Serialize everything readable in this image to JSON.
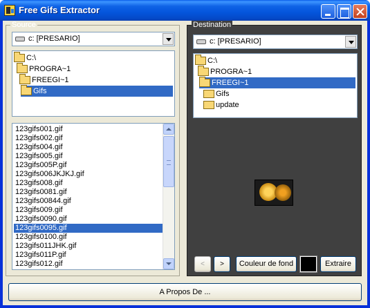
{
  "window": {
    "title": "Free Gifs Extractor"
  },
  "source": {
    "legend": "Source",
    "drive": "c: [PRESARIO]",
    "tree": [
      "C:\\",
      "PROGRA~1",
      "FREEGI~1",
      "Gifs"
    ],
    "selected_tree_index": 3,
    "files": [
      "123gifs001.gif",
      "123gifs002.gif",
      "123gifs004.gif",
      "123gifs005.gif",
      "123gifs005P.gif",
      "123gifs006JKJKJ.gif",
      "123gifs008.gif",
      "123gifs0081.gif",
      "123gifs00844.gif",
      "123gifs009.gif",
      "123gifs0090.gif",
      "123gifs0095.gif",
      "123gifs0100.gif",
      "123gifs011JHK.gif",
      "123gifs011P.gif",
      "123gifs012.gif"
    ],
    "selected_file_index": 11
  },
  "destination": {
    "legend": "Destination",
    "drive": "c: [PRESARIO]",
    "tree": [
      "C:\\",
      "PROGRA~1",
      "FREEGI~1",
      "Gifs",
      "update"
    ],
    "selected_tree_index": 2
  },
  "buttons": {
    "prev": "<",
    "next": ">",
    "background_color": "Couleur de fond",
    "extract": "Extraire",
    "about": "A Propos De ..."
  },
  "colors": {
    "selection": "#316ac5",
    "background_swatch": "#000000",
    "dest_panel": "#404040"
  }
}
